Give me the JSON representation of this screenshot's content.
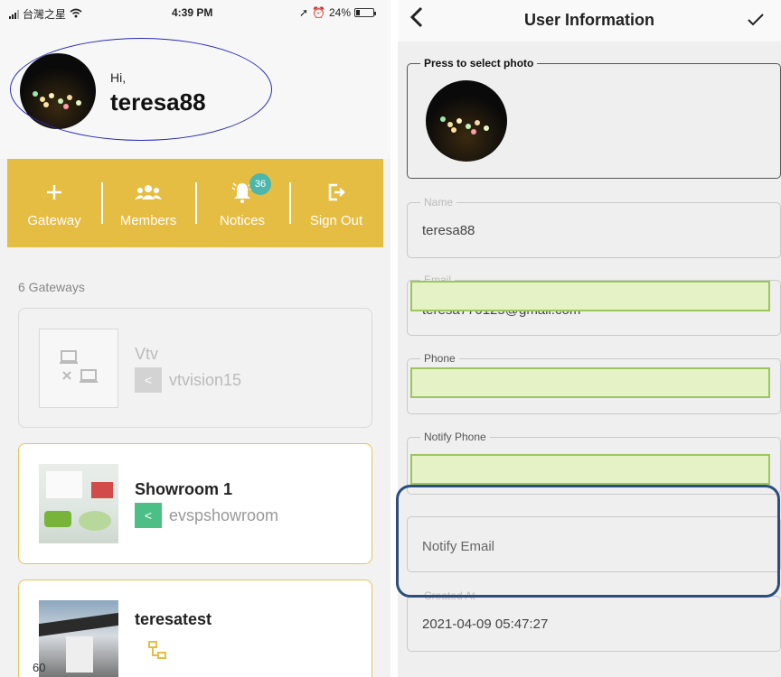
{
  "left": {
    "status": {
      "carrier": "台灣之星",
      "time": "4:39 PM",
      "battery_percent": 24,
      "battery_label": "24%"
    },
    "profile": {
      "greeting": "Hi,",
      "username": "teresa88"
    },
    "actions": [
      {
        "label": "Gateway",
        "icon": "plus-icon"
      },
      {
        "label": "Members",
        "icon": "members-icon"
      },
      {
        "label": "Notices",
        "icon": "bell-icon",
        "badge": "36"
      },
      {
        "label": "Sign Out",
        "icon": "sign-out-icon"
      }
    ],
    "gateway_count": "6  Gateways",
    "gateways": [
      {
        "title": "Vtv",
        "subtitle": "vtvision15",
        "status": "offline"
      },
      {
        "title": "Showroom 1",
        "subtitle": "evspshowroom",
        "status": "online"
      },
      {
        "title": "teresatest",
        "subtitle": "",
        "status": "online"
      }
    ],
    "footer_number": "60"
  },
  "right": {
    "title": "User Information",
    "photo_legend": "Press to select photo",
    "fields": {
      "name_label": "Name",
      "name_value": "teresa88",
      "email_label": "Email",
      "email_value": "teresa770125@gmail.com",
      "phone_label": "Phone",
      "notify_phone_label": "Notify Phone",
      "notify_email_placeholder": "Notify Email",
      "created_label": "Created At",
      "created_value": "2021-04-09 05:47:27"
    }
  },
  "colors": {
    "accent_yellow": "#e6bd43",
    "badge_teal": "#4db6ac",
    "highlight_green": "#e5f2c6",
    "highlight_blue": "#2c4e7c",
    "circle_blue": "#2a2ab8"
  }
}
